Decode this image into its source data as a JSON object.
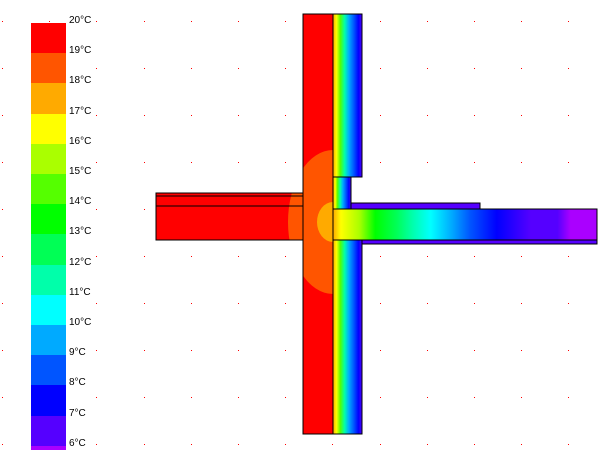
{
  "legend": {
    "title": "Temperature scale",
    "labels": [
      "20°C",
      "19°C",
      "18°C",
      "17°C",
      "16°C",
      "15°C",
      "14°C",
      "13°C",
      "12°C",
      "11°C",
      "10°C",
      "9°C",
      "8°C",
      "7°C",
      "6°C"
    ],
    "colors": [
      "#ff0000",
      "#ff5500",
      "#ffaa00",
      "#ffff00",
      "#aaff00",
      "#55ff00",
      "#00ff00",
      "#00ff55",
      "#00ffaa",
      "#00ffff",
      "#00aaff",
      "#0055ff",
      "#0000ff",
      "#5500ff",
      "#aa00ff"
    ]
  }
}
